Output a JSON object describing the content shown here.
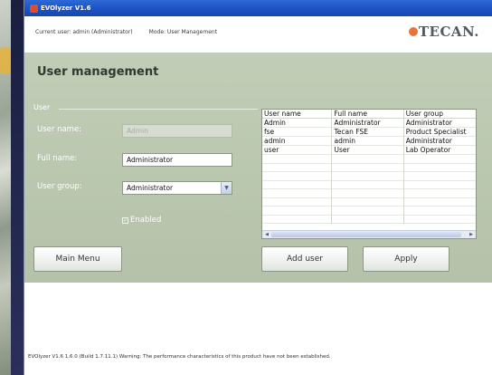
{
  "window": {
    "title": "EVOlyzer V1.6"
  },
  "infobar": {
    "current_user": "Current user: admin (Administrator)",
    "mode": "Mode: User Management",
    "logo_text": "TECAN."
  },
  "panel": {
    "title": "User management",
    "group_legend": "User",
    "fields": {
      "user_name_label": "User name:",
      "user_name_value": "Admin",
      "full_name_label": "Full name:",
      "full_name_value": "Administrator",
      "user_group_label": "User group:",
      "user_group_value": "Administrator",
      "enabled_label": "Enabled",
      "enabled_checked": true
    }
  },
  "user_table": {
    "columns": [
      "User name",
      "Full name",
      "User group"
    ],
    "rows": [
      [
        "Admin",
        "Administrator",
        "Administrator"
      ],
      [
        "fse",
        "Tecan FSE",
        "Product Specialist"
      ],
      [
        "admin",
        "admin",
        "Administrator"
      ],
      [
        "user",
        "User",
        "Lab Operator"
      ]
    ]
  },
  "buttons": {
    "main_menu": "Main Menu",
    "add_user": "Add user",
    "apply": "Apply"
  },
  "status": {
    "text": "EVOlyzer V1.6 1.6.0 (Build 1.7.11.1) Warning: The performance characteristics of this product have not been established."
  },
  "colors": {
    "titlebar": "#1d53c4",
    "panel": "#b9c6ad",
    "logo_accent": "#e8743b"
  }
}
